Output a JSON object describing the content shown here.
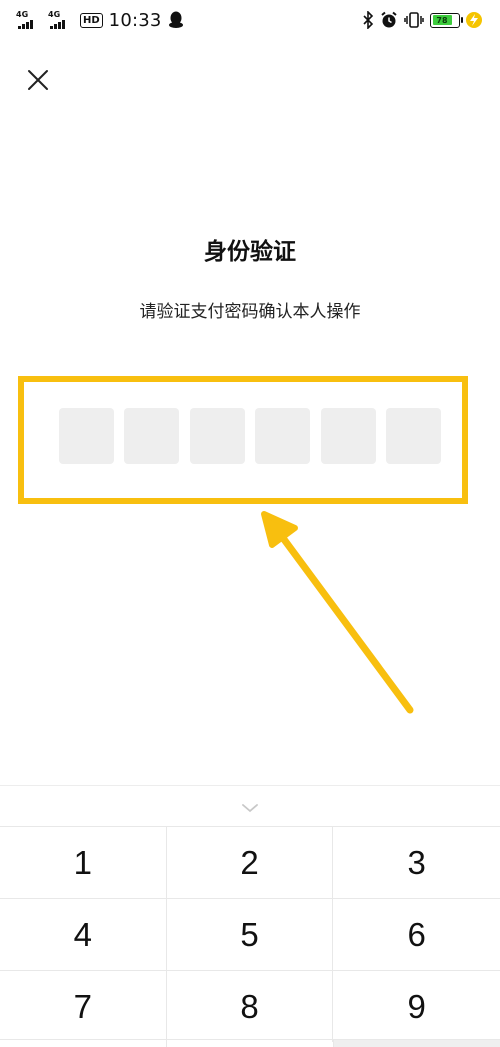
{
  "status_bar": {
    "sim1_network": "4G",
    "sim2_network": "4G",
    "hd_badge": "HD",
    "time": "10:33",
    "battery_level": "78",
    "icons": [
      "qq-icon",
      "bluetooth-icon",
      "alarm-icon",
      "vibrate-icon",
      "battery-icon",
      "charging-icon"
    ]
  },
  "dialog": {
    "title": "身份验证",
    "subtitle": "请验证支付密码确认本人操作",
    "pin_length": 6
  },
  "keypad": {
    "keys": [
      "1",
      "2",
      "3",
      "4",
      "5",
      "6",
      "7",
      "8",
      "9"
    ]
  },
  "colors": {
    "highlight": "#f8bf0f",
    "pin_cell": "#eeeeee",
    "battery_fill": "#3dcc3d"
  }
}
